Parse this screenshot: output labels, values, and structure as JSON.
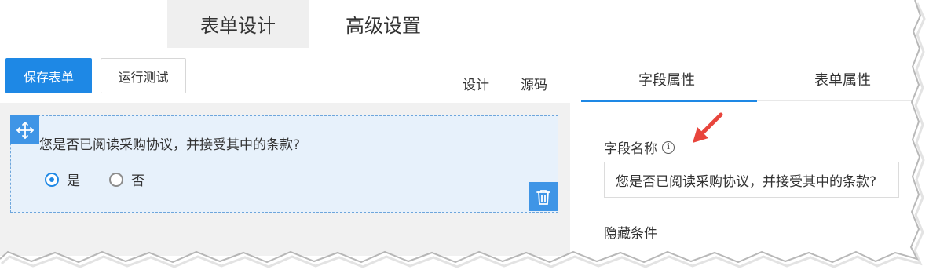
{
  "top_tabs": [
    {
      "label": "表单设计",
      "active": true
    },
    {
      "label": "高级设置",
      "active": false
    }
  ],
  "toolbar": {
    "save_label": "保存表单",
    "test_label": "运行测试",
    "design_label": "设计",
    "source_label": "源码"
  },
  "form_canvas": {
    "question": "您是否已阅读采购协议，并接受其中的条款?",
    "options": [
      {
        "label": "是",
        "checked": true
      },
      {
        "label": "否",
        "checked": false
      }
    ]
  },
  "right_panel": {
    "tabs": [
      {
        "label": "字段属性",
        "active": true
      },
      {
        "label": "表单属性",
        "active": false
      }
    ],
    "field_name_label": "字段名称",
    "field_name_value": "您是否已阅读采购协议，并接受其中的条款?",
    "hidden_condition_label": "隐藏条件"
  },
  "colors": {
    "accent": "#1e88e5",
    "handle": "#3f95e6",
    "card_bg": "#e7f1fb",
    "canvas_bg": "#f1f1f1",
    "annotation_arrow": "#e8453c"
  },
  "icons": {
    "move": "move-arrows-icon",
    "delete": "trash-icon",
    "info": "info-circle-icon",
    "annotation": "red-arrow-icon"
  }
}
